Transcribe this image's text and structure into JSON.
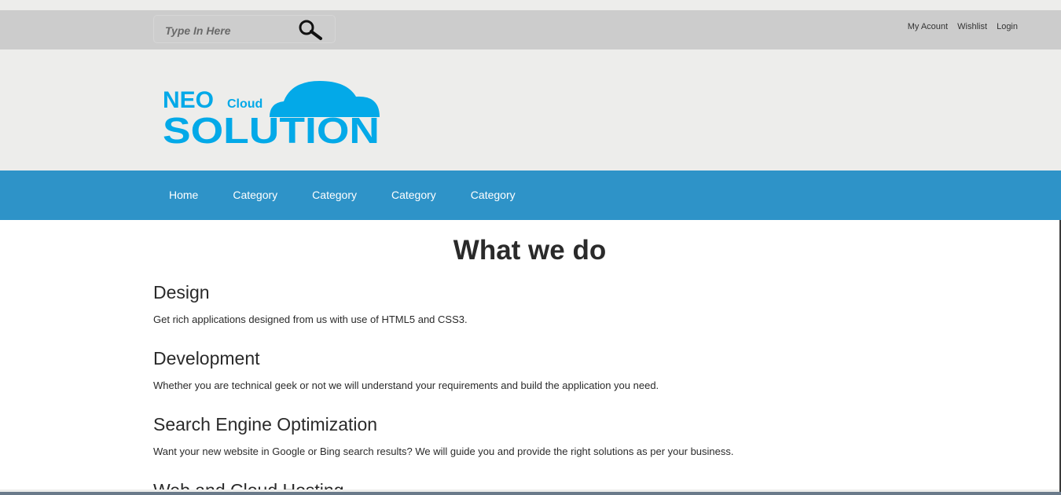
{
  "search": {
    "placeholder": "Type In Here"
  },
  "account_links": [
    "My Acount",
    "Wishlist",
    "Login"
  ],
  "logo": {
    "line1": "NEO",
    "line1_small": "Cloud",
    "line2": "SOLUTION",
    "color": "#03a9e8"
  },
  "nav": [
    "Home",
    "Category",
    "Category",
    "Category",
    "Category"
  ],
  "colors": {
    "nav_bg": "#2e93c8",
    "topbar_bg": "#cccccc",
    "header_bg": "#ededeb"
  },
  "main": {
    "title": "What we do",
    "sections": [
      {
        "heading": "Design",
        "text": "Get rich applications designed from us with use of HTML5 and CSS3."
      },
      {
        "heading": "Development",
        "text": "Whether you are technical geek or not we will understand your requirements and build the application you need."
      },
      {
        "heading": "Search Engine Optimization",
        "text": "Want your new website in Google or Bing search results? We will guide you and provide the right solutions as per your business."
      },
      {
        "heading": "Web and Cloud Hosting"
      }
    ]
  }
}
